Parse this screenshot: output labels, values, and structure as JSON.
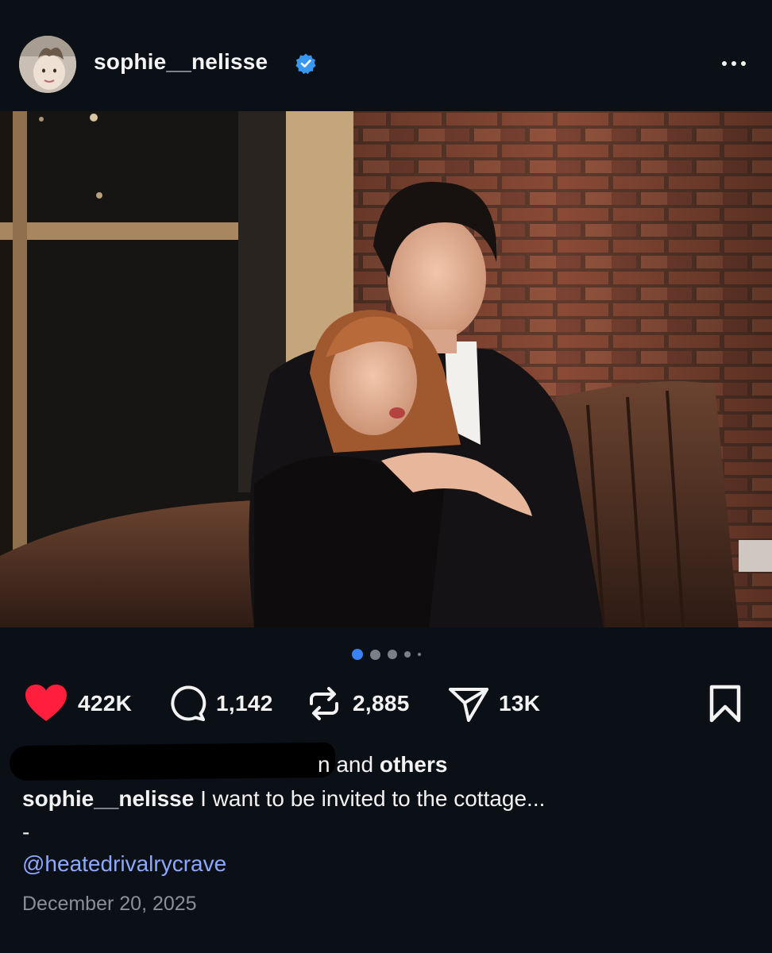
{
  "header": {
    "username": "sophie__nelisse",
    "verified": true,
    "more_icon": "more-horizontal-icon"
  },
  "post": {
    "carousel": {
      "total": 5,
      "active": 1
    }
  },
  "actions": {
    "likes": "422K",
    "comments": "1,142",
    "reposts": "2,885",
    "shares": "13K",
    "like_color": "#ff1f3d"
  },
  "liked_by": {
    "visible_fragment": "n",
    "and_text": "and",
    "others": "others"
  },
  "caption": {
    "author": "sophie__nelisse",
    "text": "I want to be invited to the cottage...",
    "separator": "-",
    "mention": "@heatedrivalrycrave"
  },
  "date": "December 20, 2025",
  "colors": {
    "background": "#0b0f16",
    "accent_link": "#8ea8ff",
    "verified_badge": "#3897f0",
    "active_dot": "#3b82f6"
  }
}
